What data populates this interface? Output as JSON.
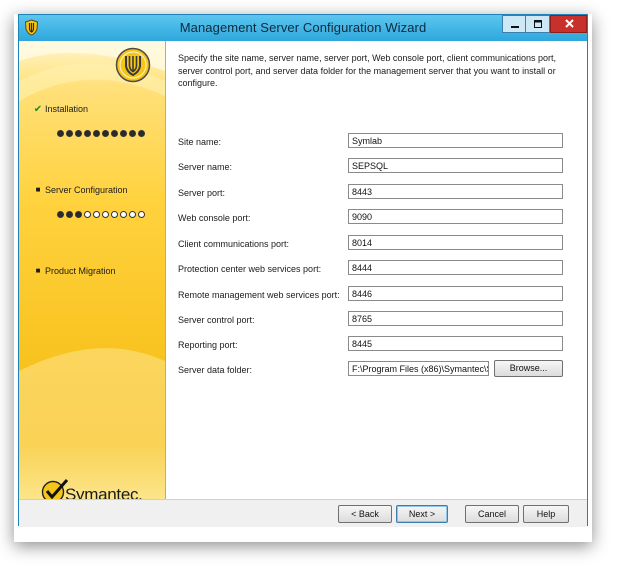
{
  "window": {
    "title": "Management Server Configuration Wizard"
  },
  "sidebar": {
    "steps": [
      {
        "label": "Installation",
        "status": "complete",
        "filled": 10,
        "total": 10
      },
      {
        "label": "Server Configuration",
        "status": "current",
        "filled": 3,
        "total": 10
      },
      {
        "label": "Product Migration",
        "status": "pending"
      }
    ],
    "logo_text": "Symantec."
  },
  "main": {
    "intro": "Specify the site name, server name, server port, Web console port, client communications port, server control port, and server data folder for the management server that you want to install or configure.",
    "fields": [
      {
        "label": "Site name:",
        "value": "Symlab"
      },
      {
        "label": "Server name:",
        "value": "SEPSQL"
      },
      {
        "label": "Server port:",
        "value": "8443"
      },
      {
        "label": "Web console port:",
        "value": "9090"
      },
      {
        "label": "Client communications port:",
        "value": "8014"
      },
      {
        "label": "Protection center web services port:",
        "value": "8444"
      },
      {
        "label": "Remote management web services port:",
        "value": "8446"
      },
      {
        "label": "Server control port:",
        "value": "8765"
      },
      {
        "label": "Reporting port:",
        "value": "8445"
      },
      {
        "label": "Server data folder:",
        "value": "F:\\Program Files (x86)\\Symantec\\S"
      }
    ],
    "browse_label": "Browse..."
  },
  "footer": {
    "back_label": "< Back",
    "next_label": "Next >",
    "cancel_label": "Cancel",
    "help_label": "Help"
  }
}
